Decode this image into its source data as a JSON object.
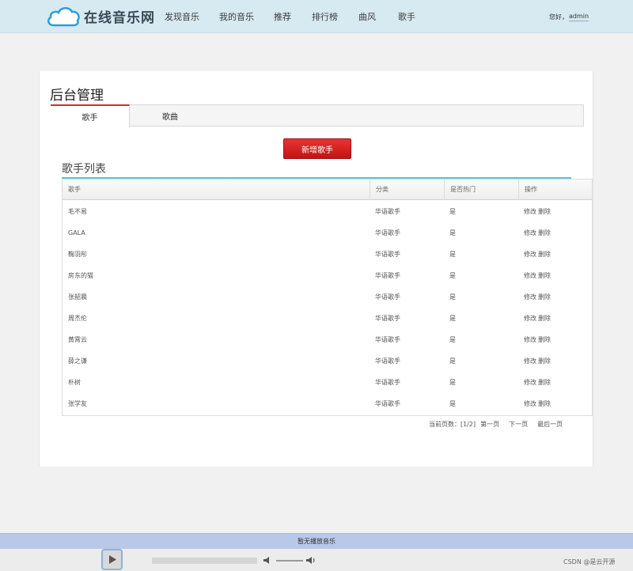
{
  "header": {
    "logo_text": "在线音乐网",
    "nav": [
      "发现音乐",
      "我的音乐",
      "推荐",
      "排行榜",
      "曲风",
      "歌手"
    ],
    "greeting": "您好，",
    "username": "admin"
  },
  "panel": {
    "title": "后台管理",
    "tabs": [
      {
        "label": "歌手",
        "active": true
      },
      {
        "label": "歌曲",
        "active": false
      }
    ],
    "add_button": "新增歌手",
    "list_title": "歌手列表"
  },
  "table": {
    "headers": [
      "歌手",
      "分类",
      "是否热门",
      "操作"
    ],
    "rows": [
      {
        "name": "毛不易",
        "category": "华语歌手",
        "hot": "是",
        "edit": "修改",
        "delete": "删除"
      },
      {
        "name": "GALA",
        "category": "华语歌手",
        "hot": "是",
        "edit": "修改",
        "delete": "删除"
      },
      {
        "name": "鞠羽彤",
        "category": "华语歌手",
        "hot": "是",
        "edit": "修改",
        "delete": "删除"
      },
      {
        "name": "房东的猫",
        "category": "华语歌手",
        "hot": "是",
        "edit": "修改",
        "delete": "删除"
      },
      {
        "name": "张韶晨",
        "category": "华语歌手",
        "hot": "是",
        "edit": "修改",
        "delete": "删除"
      },
      {
        "name": "周杰伦",
        "category": "华语歌手",
        "hot": "是",
        "edit": "修改",
        "delete": "删除"
      },
      {
        "name": "黄霄云",
        "category": "华语歌手",
        "hot": "是",
        "edit": "修改",
        "delete": "删除"
      },
      {
        "name": "薛之谦",
        "category": "华语歌手",
        "hot": "是",
        "edit": "修改",
        "delete": "删除"
      },
      {
        "name": "朴树",
        "category": "华语歌手",
        "hot": "是",
        "edit": "修改",
        "delete": "删除"
      },
      {
        "name": "张学友",
        "category": "华语歌手",
        "hot": "是",
        "edit": "修改",
        "delete": "删除"
      }
    ]
  },
  "pager": {
    "current_label": "当前页数：[1/2]",
    "first": "第一页",
    "next": "下一页",
    "last": "最后一页"
  },
  "player": {
    "status": "暂无播放音乐",
    "play_icon": "play-icon",
    "volume_icon": "volume-icon"
  },
  "watermark": "CSDN @是云开源",
  "colors": {
    "topbar": "#d7e9f1",
    "accent_red": "#d42a2a",
    "list_underline": "#5bc2d6",
    "player_status": "#b9c8e8"
  }
}
